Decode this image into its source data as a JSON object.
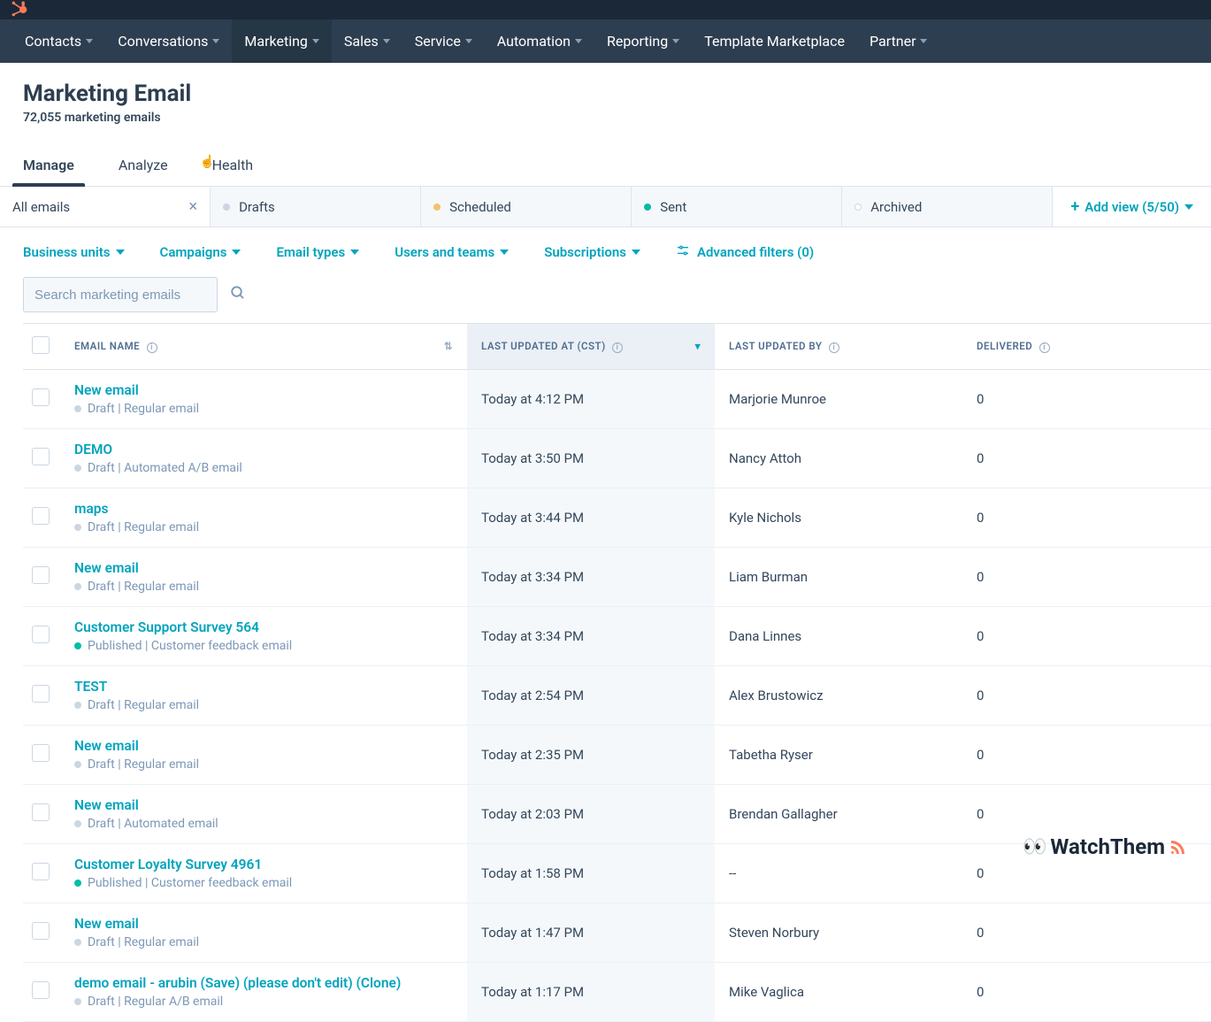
{
  "nav": {
    "items": [
      "Contacts",
      "Conversations",
      "Marketing",
      "Sales",
      "Service",
      "Automation",
      "Reporting",
      "Template Marketplace",
      "Partner"
    ],
    "activeIndex": 2
  },
  "page": {
    "title": "Marketing Email",
    "subtitle": "72,055 marketing emails"
  },
  "tabs": {
    "items": [
      "Manage",
      "Analyze",
      "Health"
    ],
    "activeIndex": 0
  },
  "views": {
    "items": [
      {
        "label": "All emails",
        "dotColor": "",
        "closable": true
      },
      {
        "label": "Drafts",
        "dotColor": "#cbd6e2"
      },
      {
        "label": "Scheduled",
        "dotColor": "#f5c26b"
      },
      {
        "label": "Sent",
        "dotColor": "#00bda5"
      },
      {
        "label": "Archived",
        "dotColor": "#ffffff",
        "dotBorder": "#cbd6e2"
      }
    ],
    "addView": "Add view (5/50)"
  },
  "filters": {
    "items": [
      "Business units",
      "Campaigns",
      "Email types",
      "Users and teams",
      "Subscriptions"
    ],
    "advanced": "Advanced filters (0)"
  },
  "search": {
    "placeholder": "Search marketing emails"
  },
  "columns": {
    "name": "EMAIL NAME",
    "updated": "LAST UPDATED AT (CST)",
    "by": "LAST UPDATED BY",
    "delivered": "DELIVERED"
  },
  "rows": [
    {
      "name": "New email",
      "status": "Draft",
      "type": "Regular email",
      "published": false,
      "updated": "Today at 4:12 PM",
      "by": "Marjorie Munroe",
      "delivered": "0"
    },
    {
      "name": "DEMO",
      "status": "Draft",
      "type": "Automated A/B email",
      "published": false,
      "updated": "Today at 3:50 PM",
      "by": "Nancy Attoh",
      "delivered": "0"
    },
    {
      "name": "maps",
      "status": "Draft",
      "type": "Regular email",
      "published": false,
      "updated": "Today at 3:44 PM",
      "by": "Kyle Nichols",
      "delivered": "0"
    },
    {
      "name": "New email",
      "status": "Draft",
      "type": "Regular email",
      "published": false,
      "updated": "Today at 3:34 PM",
      "by": "Liam Burman",
      "delivered": "0"
    },
    {
      "name": "Customer Support Survey 564",
      "status": "Published",
      "type": "Customer feedback email",
      "published": true,
      "updated": "Today at 3:34 PM",
      "by": "Dana Linnes",
      "delivered": "0"
    },
    {
      "name": "TEST",
      "status": "Draft",
      "type": "Regular email",
      "published": false,
      "updated": "Today at 2:54 PM",
      "by": "Alex Brustowicz",
      "delivered": "0"
    },
    {
      "name": "New email",
      "status": "Draft",
      "type": "Regular email",
      "published": false,
      "updated": "Today at 2:35 PM",
      "by": "Tabetha Ryser",
      "delivered": "0"
    },
    {
      "name": "New email",
      "status": "Draft",
      "type": "Automated email",
      "published": false,
      "updated": "Today at 2:03 PM",
      "by": "Brendan Gallagher",
      "delivered": "0"
    },
    {
      "name": "Customer Loyalty Survey 4961",
      "status": "Published",
      "type": "Customer feedback email",
      "published": true,
      "updated": "Today at 1:58 PM",
      "by": "--",
      "delivered": "0"
    },
    {
      "name": "New email",
      "status": "Draft",
      "type": "Regular email",
      "published": false,
      "updated": "Today at 1:47 PM",
      "by": "Steven Norbury",
      "delivered": "0"
    },
    {
      "name": "demo email - arubin (Save) (please don't edit) (Clone)",
      "status": "Draft",
      "type": "Regular A/B email",
      "published": false,
      "updated": "Today at 1:17 PM",
      "by": "Mike Vaglica",
      "delivered": "0"
    }
  ],
  "watermark": "WatchThem"
}
